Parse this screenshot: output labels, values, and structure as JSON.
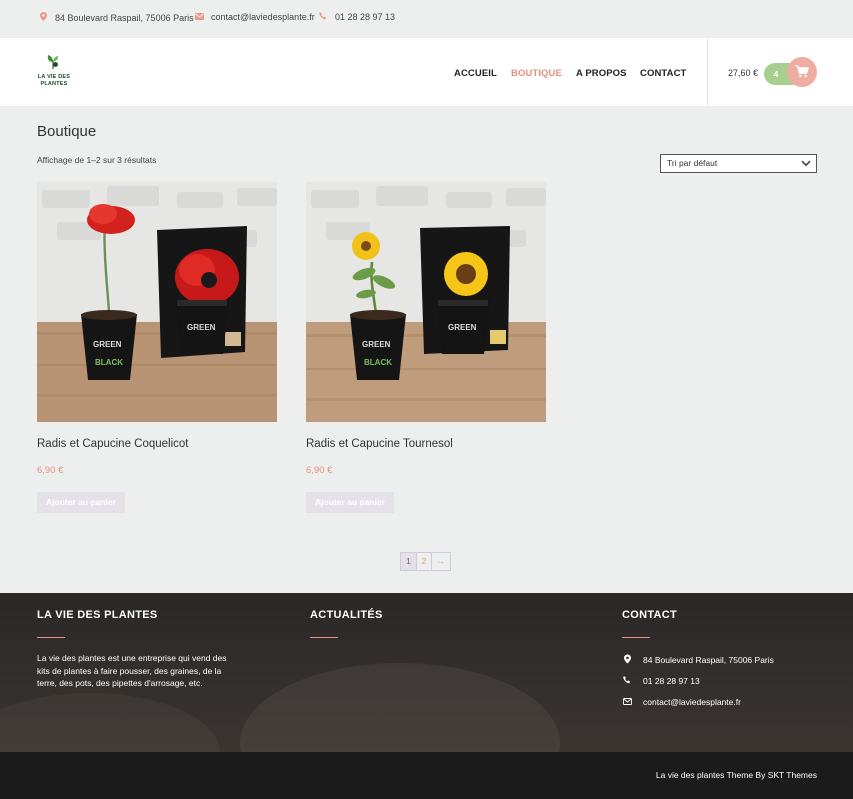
{
  "topbar": {
    "address": "84 Boulevard Raspail, 75006 Paris",
    "email": "contact@laviedesplante.fr",
    "phone": "01 28 28 97 13",
    "icons": [
      "map-marker-icon",
      "envelope-icon",
      "phone-icon"
    ]
  },
  "logo": {
    "text_line1": "LA VIE DES",
    "text_line2": "PLANTES"
  },
  "nav": {
    "items": [
      "ACCUEIL",
      "BOUTIQUE",
      "A PROPOS",
      "CONTACT"
    ],
    "active": "BOUTIQUE"
  },
  "cart": {
    "total": "27,60 €",
    "count": "4"
  },
  "main": {
    "title": "Boutique",
    "result_count": "Affichage de 1–2 sur 3 résultats",
    "sort": {
      "selected": "Tri par défaut"
    },
    "products": [
      {
        "name": "Radis et Capucine Coquelicot",
        "price": "6,90 €",
        "button": "Ajouter au panier",
        "flower": "poppy"
      },
      {
        "name": "Radis et Capucine Tournesol",
        "price": "6,90 €",
        "button": "Ajouter au panier",
        "flower": "sunflower"
      }
    ],
    "pagination": {
      "current": "1",
      "page2": "2",
      "next": "→"
    }
  },
  "footer": {
    "col1": {
      "title": "LA VIE DES PLANTES",
      "text": "La vie des plantes est une entreprise qui vend des kits de plantes à faire pousser, des graines, de la terre, des pots, des pipettes d'arrosage, etc."
    },
    "col2": {
      "title": "ACTUALITÉS"
    },
    "col3": {
      "title": "CONTACT",
      "address": "84 Boulevard Raspail, 75006 Paris",
      "phone": "01 28 28 97 13",
      "email": "contact@laviedesplante.fr"
    },
    "credit": "La vie des plantes Theme By SKT Themes"
  },
  "colors": {
    "accent": "#e88f7d",
    "cart_green": "#a9cf90",
    "footer_dark": "#1c1b1b"
  }
}
